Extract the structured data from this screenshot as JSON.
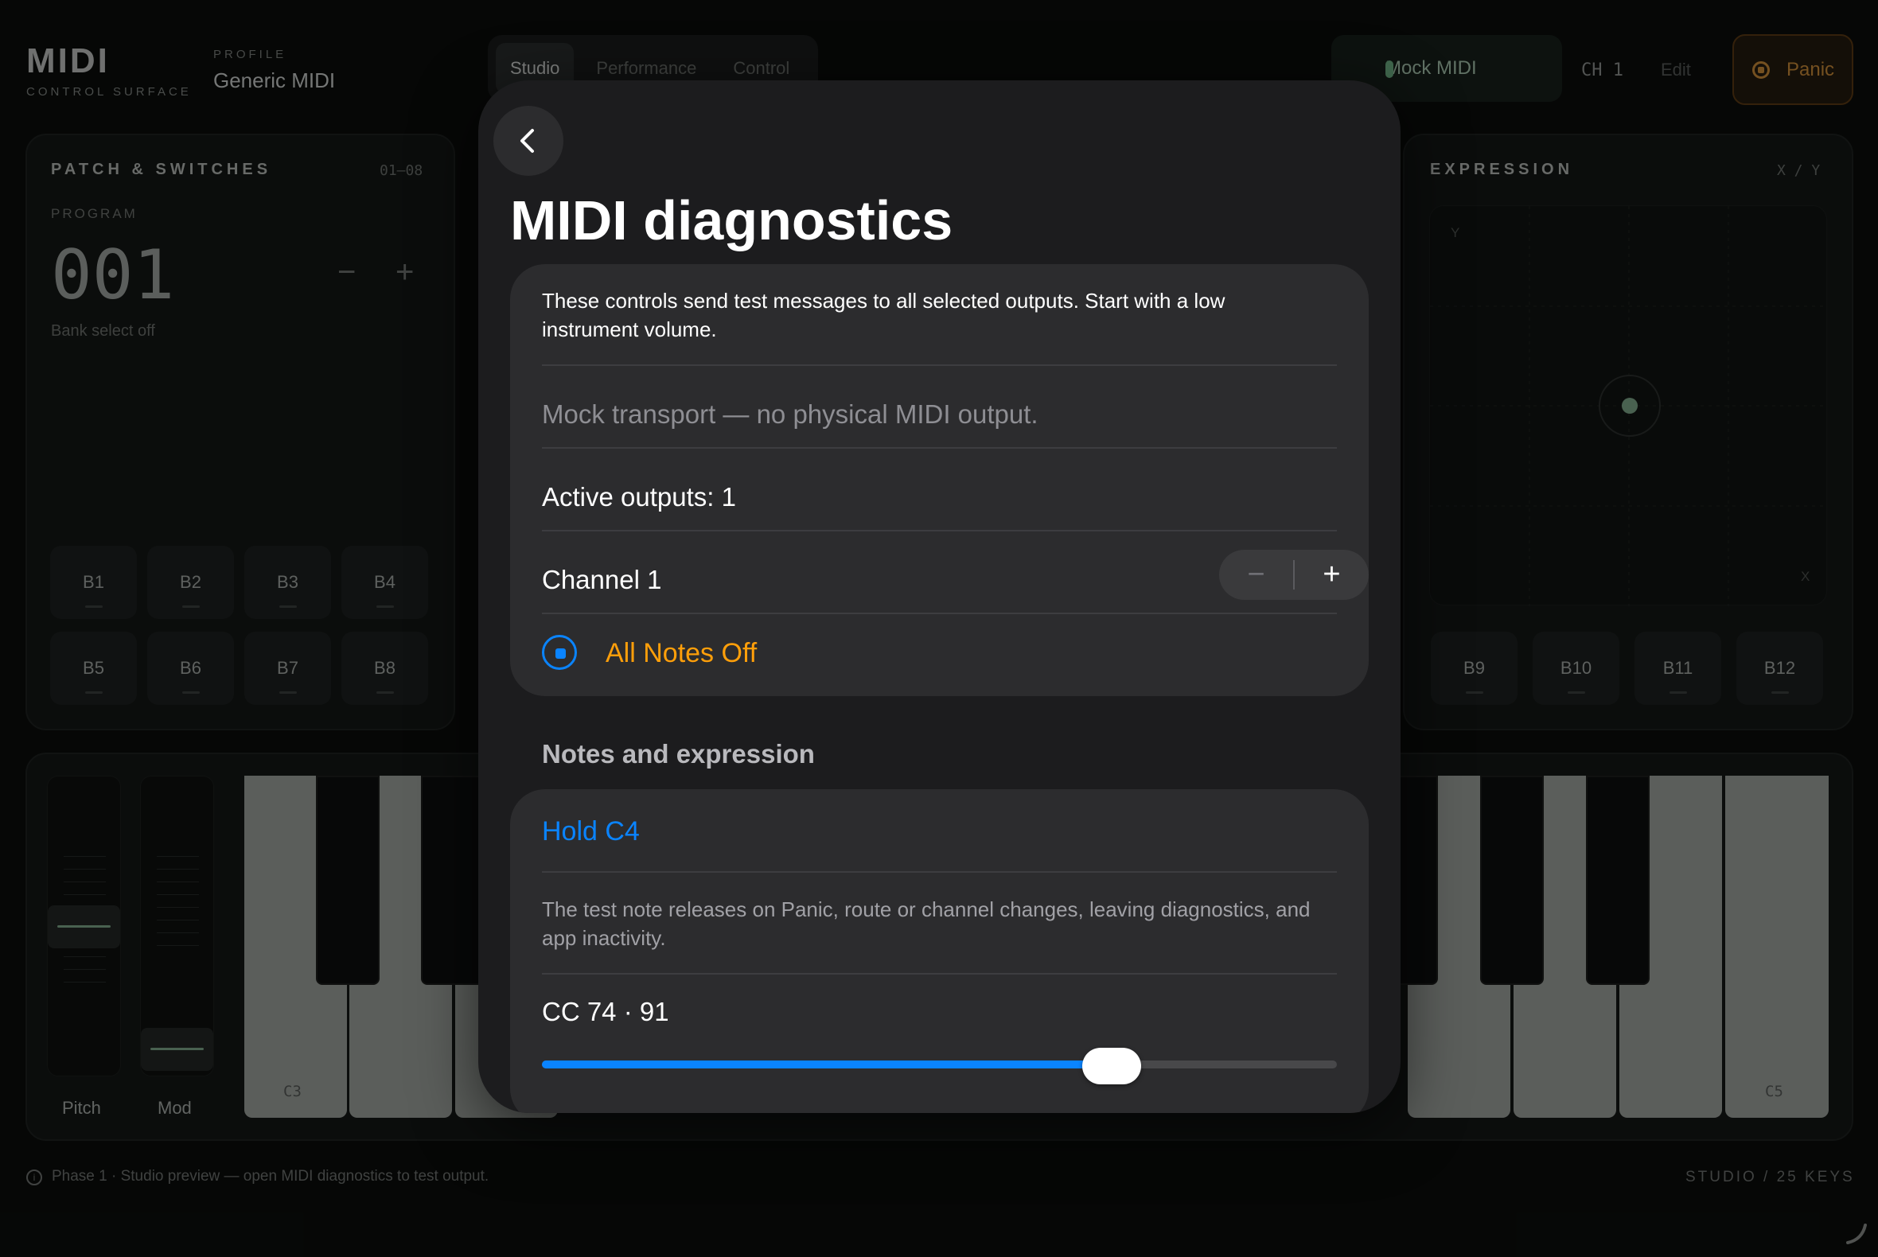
{
  "header": {
    "brand_title": "MIDI",
    "brand_subtitle": "CONTROL SURFACE",
    "profile_label": "PROFILE",
    "profile_value": "Generic MIDI",
    "tabs": [
      {
        "label": "Studio",
        "active": true
      },
      {
        "label": "Performance",
        "active": false
      },
      {
        "label": "Control",
        "active": false
      }
    ],
    "device_label": "Mock MIDI",
    "channel_label": "CH 1",
    "edit_label": "Edit",
    "panic_label": "Panic"
  },
  "patch_panel": {
    "title": "PATCH & SWITCHES",
    "range": "01–08",
    "program_label": "PROGRAM",
    "program_value": "001",
    "minus": "−",
    "plus": "+",
    "bank_text": "Bank select off",
    "pads": [
      "B1",
      "B2",
      "B3",
      "B4",
      "B5",
      "B6",
      "B7",
      "B8"
    ]
  },
  "expression_panel": {
    "title": "EXPRESSION",
    "axes_label": "X / Y",
    "y_axis": "Y",
    "x_axis": "X",
    "pads": [
      "B9",
      "B10",
      "B11",
      "B12"
    ]
  },
  "keyboard": {
    "pitch_label": "Pitch",
    "mod_label": "Mod",
    "low_key_label": "C3",
    "high_key_label": "C5"
  },
  "footer": {
    "status_text": "Phase 1 · Studio preview — open MIDI diagnostics to test output.",
    "right_text": "STUDIO / 25 KEYS"
  },
  "diagnostics": {
    "title": "MIDI diagnostics",
    "note": "These controls send test messages to all selected outputs. Start with a low instrument volume.",
    "mock_status": "Mock transport — no physical MIDI output.",
    "active_outputs": "Active outputs: 1",
    "channel": "Channel 1",
    "stepper_minus": "−",
    "stepper_plus": "+",
    "all_notes_off": "All Notes Off",
    "section_header": "Notes and expression",
    "hold_note": "Hold C4",
    "release_note": "The test note releases on Panic, route or channel changes, leaving diagnostics, and app inactivity.",
    "cc_label": "CC 74 · 91",
    "cc_value": 91,
    "cc_max": 127
  },
  "colors": {
    "accent_blue": "#0a84ff",
    "warning_orange": "#ff9f0a",
    "panic_amber": "#c98a38",
    "status_green": "#7ea88a"
  }
}
